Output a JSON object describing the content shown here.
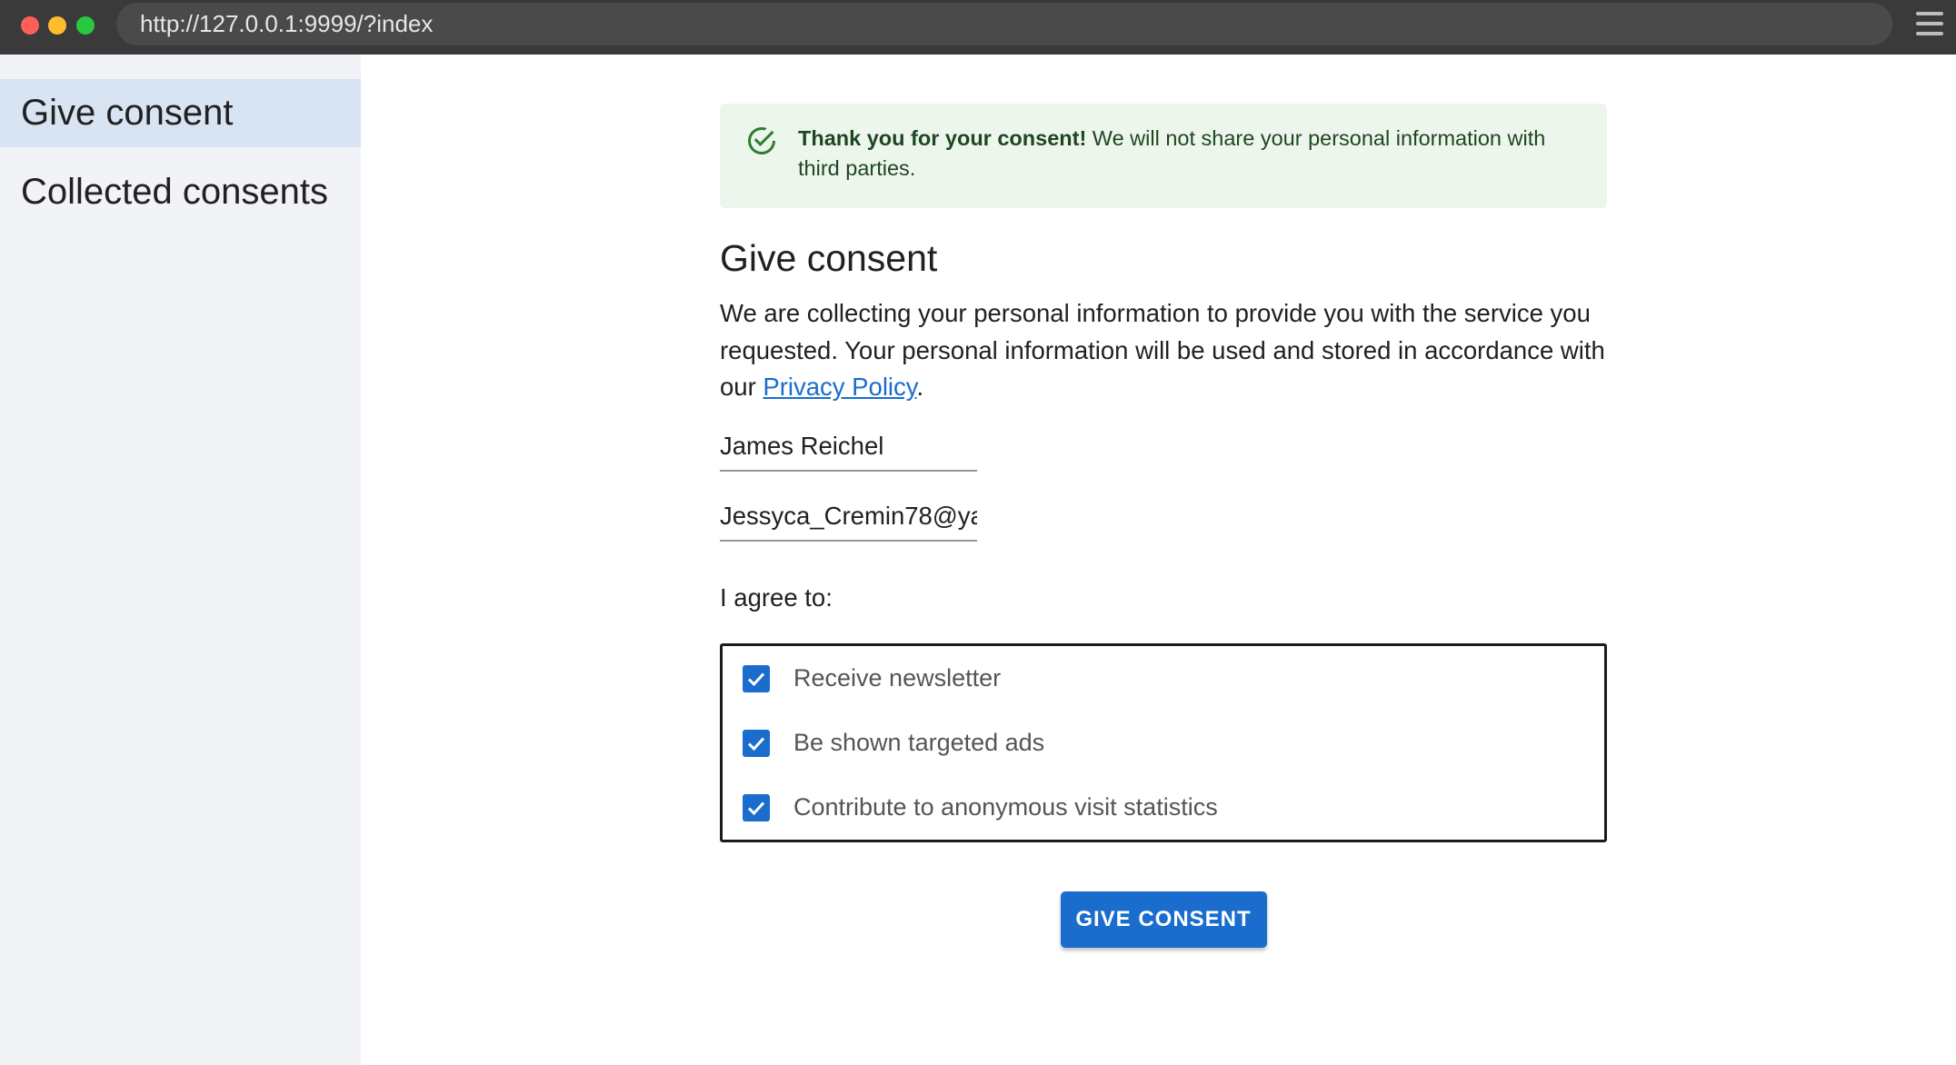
{
  "browser": {
    "url": "http://127.0.0.1:9999/?index"
  },
  "sidebar": {
    "items": [
      {
        "label": "Give consent",
        "active": true
      },
      {
        "label": "Collected consents",
        "active": false
      }
    ]
  },
  "alert": {
    "bold": "Thank you for your consent!",
    "message": " We will not share your personal information with third parties."
  },
  "form": {
    "title": "Give consent",
    "intro_before_link": "We are collecting your personal information to provide you with the service you requested. Your personal information will be used and stored in accordance with our ",
    "privacy_link": "Privacy Policy",
    "intro_after_link": ".",
    "name_value": "James Reichel",
    "email_value": "Jessyca_Cremin78@ya",
    "agree_label": "I agree to:",
    "options": [
      {
        "label": "Receive newsletter",
        "checked": true
      },
      {
        "label": "Be shown targeted ads",
        "checked": true
      },
      {
        "label": "Contribute to anonymous visit statistics",
        "checked": true
      }
    ],
    "submit_label": "GIVE CONSENT"
  },
  "colors": {
    "accent": "#1a6dcc",
    "success_bg": "#edf6ed",
    "success_fg": "#1e4620",
    "sidebar_bg": "#f1f3f6",
    "sidebar_active": "#d9e4f3"
  }
}
